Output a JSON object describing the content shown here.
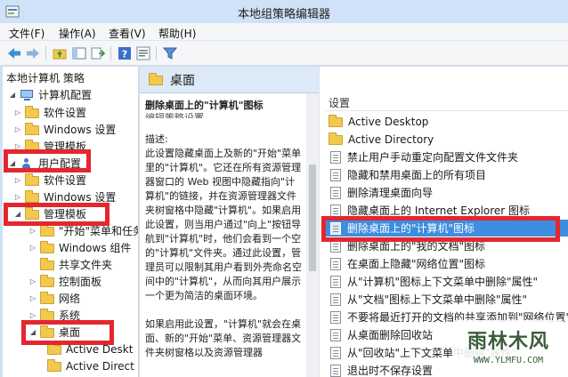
{
  "window": {
    "title": "本地组策略编辑器"
  },
  "menu": [
    "文件(F)",
    "操作(A)",
    "查看(V)",
    "帮助(H)"
  ],
  "toolbar_icons": [
    "back-icon",
    "forward-icon",
    "up-folder-icon",
    "show-hide-tree-icon",
    "export-list-icon",
    "help-icon",
    "properties-icon",
    "filter-icon"
  ],
  "tree": {
    "items": [
      "本地计算机 策略",
      "计算机配置",
      "软件设置",
      "Windows 设置",
      "管理模板",
      "用户配置",
      "软件设置",
      "Windows 设置",
      "管理模板",
      "\"开始\"菜单和任务",
      "Windows 组件",
      "共享文件夹",
      "控制面板",
      "网络",
      "系统",
      "桌面",
      "Active Deskt",
      "Active Direct"
    ]
  },
  "middle": {
    "header": "桌面",
    "policy_title": "删除桌面上的\"计算机\"图标",
    "edit_link": "编辑策略设置",
    "desc_label": "描述:",
    "desc_paragraphs": [
      "此设置隐藏桌面上及新的\"开始\"菜单里的\"计算机\"。它还在所有资源管理器窗口的 Web 视图中隐藏指向\"计算机\"的链接，并在资源管理器文件夹树窗格中隐藏\"计算机\"。如果启用此设置，则当用户通过\"向上\"按钮导航到\"计算机\"时，他们会看到一个空的\"计算机\"文件夹。通过此设置，管理员可以限制其用户看到外壳命名空间中的\"计算机\"，从而向其用户展示一个更为简洁的桌面环境。",
      "如果启用此设置，\"计算机\"就会在桌面、新的\"开始\"菜单、资源管理器文件夹树窗格以及资源管理器"
    ]
  },
  "right": {
    "column_header": "设置",
    "items": [
      {
        "text": "Active Desktop",
        "type": "folder"
      },
      {
        "text": "Active Directory",
        "type": "folder"
      },
      {
        "text": "禁止用户手动重定向配置文件文件夹",
        "type": "setting"
      },
      {
        "text": "隐藏和禁用桌面上的所有项目",
        "type": "setting"
      },
      {
        "text": "删除清理桌面向导",
        "type": "setting"
      },
      {
        "text": "隐藏桌面上的 Internet Explorer 图标",
        "type": "setting"
      },
      {
        "text": "删除桌面上的\"计算机\"图标",
        "type": "setting",
        "selected": true
      },
      {
        "text": "删除桌面上的\"我的文档\"图标",
        "type": "setting"
      },
      {
        "text": "在桌面上隐藏\"网络位置\"图标",
        "type": "setting"
      },
      {
        "text": "从\"计算机\"图标上下文菜单中删除\"属性\"",
        "type": "setting"
      },
      {
        "text": "从\"文档\"图标上下文菜单中删除\"属性\"",
        "type": "setting"
      },
      {
        "text": "不要将最近打开的文档的共享添加到\"网络位置\"",
        "type": "setting"
      },
      {
        "text": "从桌面删除回收站",
        "type": "setting"
      },
      {
        "text": "从\"回收站\"上下文菜单中删除\"属性\"",
        "type": "setting"
      },
      {
        "text": "退出时不保存设置",
        "type": "setting"
      }
    ]
  },
  "watermark": {
    "main": "雨林木风",
    "sub": "WWW.YLMFU.COM"
  },
  "colors": {
    "highlight": "#e4262f",
    "selection": "#3d8ee0"
  }
}
